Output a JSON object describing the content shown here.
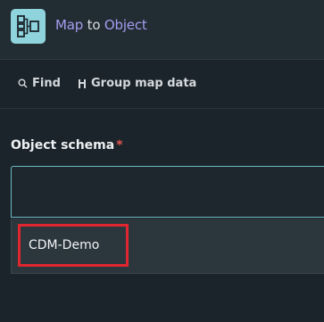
{
  "header": {
    "title_map": "Map",
    "title_to": "to",
    "title_object": "Object",
    "icon": "workflow-tree-icon"
  },
  "toolbar": {
    "find_label": "Find",
    "group_label": "Group map data",
    "find_icon": "search-icon",
    "group_icon": "group-icon"
  },
  "form": {
    "label": "Object schema",
    "required_mark": "*",
    "input_value": "",
    "options": [
      "CDM-Demo"
    ]
  },
  "colors": {
    "accent_link": "#a59df0",
    "highlight_box": "#e0262f",
    "input_border": "#6fb8c4",
    "required": "#e0554f"
  }
}
